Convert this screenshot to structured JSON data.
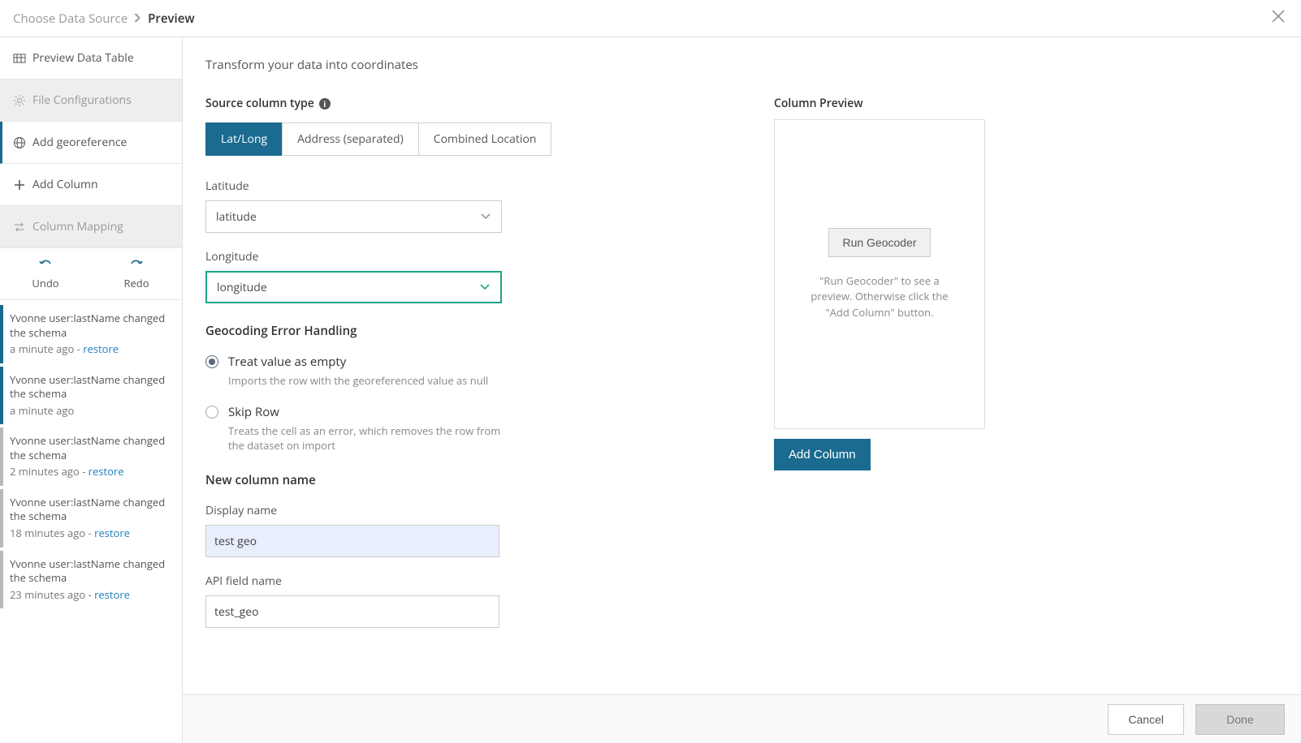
{
  "header": {
    "crumb1": "Choose Data Source",
    "crumb2": "Preview"
  },
  "sidebar": {
    "items": [
      {
        "label": "Preview Data Table"
      },
      {
        "label": "File Configurations"
      },
      {
        "label": "Add georeference"
      },
      {
        "label": "Add Column"
      },
      {
        "label": "Column Mapping"
      }
    ],
    "undo": "Undo",
    "redo": "Redo",
    "history": [
      {
        "text": "Yvonne user:lastName changed the schema",
        "time": "a minute ago",
        "restore": "restore"
      },
      {
        "text": "Yvonne user:lastName changed the schema",
        "time": "a minute ago",
        "restore": ""
      },
      {
        "text": "Yvonne user:lastName changed the schema",
        "time": "2 minutes ago",
        "restore": "restore"
      },
      {
        "text": "Yvonne user:lastName changed the schema",
        "time": "18 minutes ago",
        "restore": "restore"
      },
      {
        "text": "Yvonne user:lastName changed the schema",
        "time": "23 minutes ago",
        "restore": "restore"
      }
    ]
  },
  "main": {
    "subtitle": "Transform your data into coordinates",
    "source_column_type_label": "Source column type",
    "tabs": [
      {
        "label": "Lat/Long"
      },
      {
        "label": "Address (separated)"
      },
      {
        "label": "Combined Location"
      }
    ],
    "latitude_label": "Latitude",
    "latitude_value": "latitude",
    "longitude_label": "Longitude",
    "longitude_value": "longitude",
    "error_handling_label": "Geocoding Error Handling",
    "radio1_label": "Treat value as empty",
    "radio1_help": "Imports the row with the georeferenced value as null",
    "radio2_label": "Skip Row",
    "radio2_help": "Treats the cell as an error, which removes the row from the dataset on import",
    "new_col_label": "New column name",
    "display_name_label": "Display name",
    "display_name_value": "test geo",
    "api_name_label": "API field name",
    "api_name_value": "test_geo",
    "column_preview_label": "Column Preview",
    "run_geocoder": "Run Geocoder",
    "preview_help": "\"Run Geocoder\" to see a preview. Otherwise click the \"Add Column\" button.",
    "add_column": "Add Column"
  },
  "footer": {
    "cancel": "Cancel",
    "done": "Done"
  }
}
